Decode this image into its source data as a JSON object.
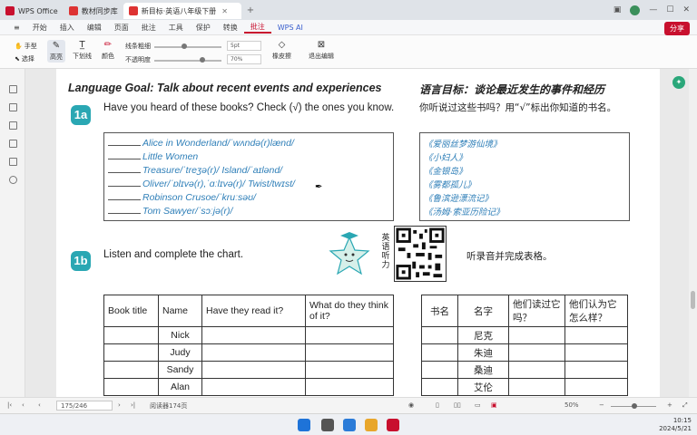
{
  "titlebar": {
    "tabs": [
      {
        "label": "WPS Office",
        "color": "#c8102e"
      },
      {
        "label": "教材同步库",
        "color": "#c8102e"
      },
      {
        "label": "新目标·英语八年级下册",
        "color": "#c8102e"
      }
    ],
    "right_icons": [
      "window-icon",
      "avatar",
      "minimize-icon",
      "maximize-icon",
      "close-icon"
    ]
  },
  "menubar": {
    "items": [
      "开始",
      "插入",
      "编辑",
      "页面",
      "批注",
      "工具",
      "保护",
      "转换",
      "批注",
      "WPS AI"
    ],
    "active_index": 8,
    "share_label": "分享"
  },
  "ribbon": {
    "hand_tool": "手型",
    "select_tool": "选择",
    "highlight": "高亮",
    "underline": "下划线",
    "color": "颜色",
    "pen_weight_label": "线条粗细",
    "opacity_label": "不透明度",
    "weight_value": "5pt",
    "opacity_value": "70%",
    "eraser": "橡皮擦",
    "exit": "退出编辑"
  },
  "page": {
    "goal_en": "Language Goal: Talk about recent events and experiences",
    "goal_cn": "语言目标：谈论最近发生的事件和经历",
    "section_1a": {
      "badge": "1a",
      "question_en": "Have you heard of these books? Check (√) the ones you know.",
      "question_cn": "你听说过这些书吗？用“√”标出你知道的书名。",
      "books_en": [
        "Alice in Wonderland/ˈwʌndə(r)lænd/",
        "Little Women",
        "Treasure/ˈtreʒə(r)/ Island/ˈaɪlənd/",
        "Oliver/ˈɒlɪvə(r),ˈɑːlɪvə(r)/ Twist/twɪst/",
        "Robinson Crusoe/ˈkruːsəʊ/",
        "Tom Sawyer/ˈsɔːjə(r)/"
      ],
      "books_cn": [
        "《爱丽丝梦游仙境》",
        "《小妇人》",
        "《金银岛》",
        "《雾都孤儿》",
        "《鲁滨逊漂流记》",
        "《汤姆·索亚历险记》"
      ]
    },
    "section_1b": {
      "badge": "1b",
      "instruction_en": "Listen and complete the chart.",
      "instruction_cn": "听录音并完成表格。",
      "qr_label": "英语听力",
      "chart_en": {
        "headers": [
          "Book title",
          "Name",
          "Have they read it?",
          "What do they think of it?"
        ],
        "names": [
          "Nick",
          "Judy",
          "Sandy",
          "Alan"
        ]
      },
      "chart_cn": {
        "headers": [
          "书名",
          "名字",
          "他们读过它吗？",
          "他们认为它怎么样？"
        ],
        "names": [
          "尼克",
          "朱迪",
          "桑迪",
          "艾伦"
        ]
      }
    }
  },
  "statusbar": {
    "page_input": "175/246",
    "reading_mode": "阅读器174页",
    "zoom": "50%"
  },
  "taskbar": {
    "time": "10:15",
    "date": "2024/5/21"
  }
}
